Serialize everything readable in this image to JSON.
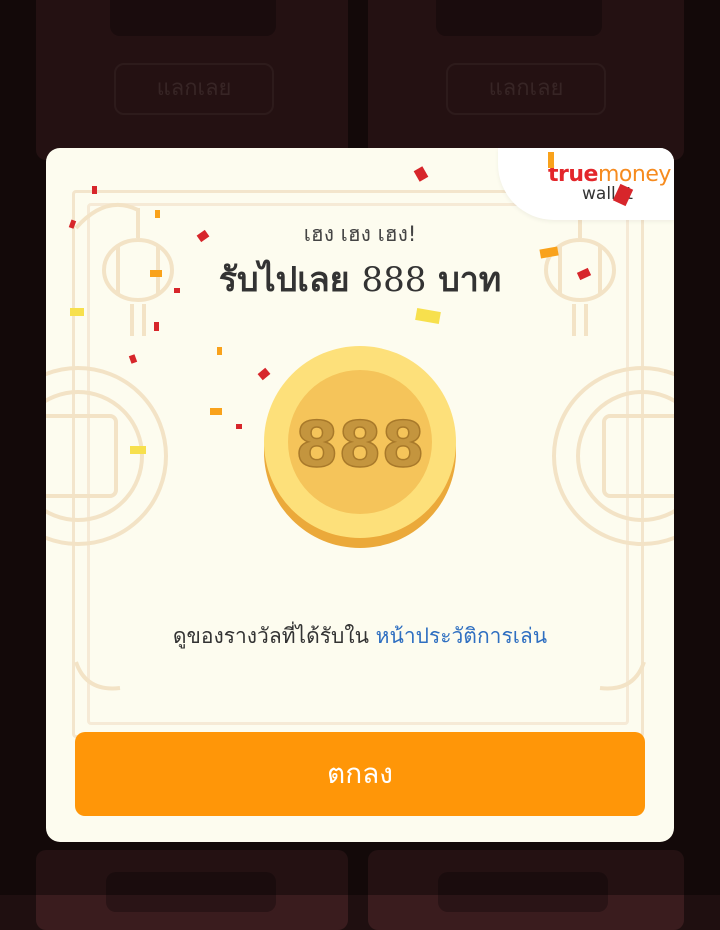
{
  "background": {
    "exchange_buttons": [
      "แลกเลย",
      "แลกเลย"
    ]
  },
  "modal": {
    "brand": {
      "true": "true",
      "money": "money",
      "wallet": "wallet"
    },
    "greeting": "เฮง เฮง เฮง!",
    "headline_prefix": "รับไปเลย",
    "amount": "888",
    "headline_suffix": "บาท",
    "coin_label": "888",
    "caption_text": "ดูของรางวัลที่ได้รับใน",
    "caption_link": "หน้าประวัติการเล่น",
    "confirm_button": "ตกลง"
  },
  "colors": {
    "accent": "#ff9608",
    "link": "#2f6fc1",
    "brand_red": "#e3262b",
    "brand_orange": "#f68b1f",
    "coin": "#f7d55e"
  }
}
